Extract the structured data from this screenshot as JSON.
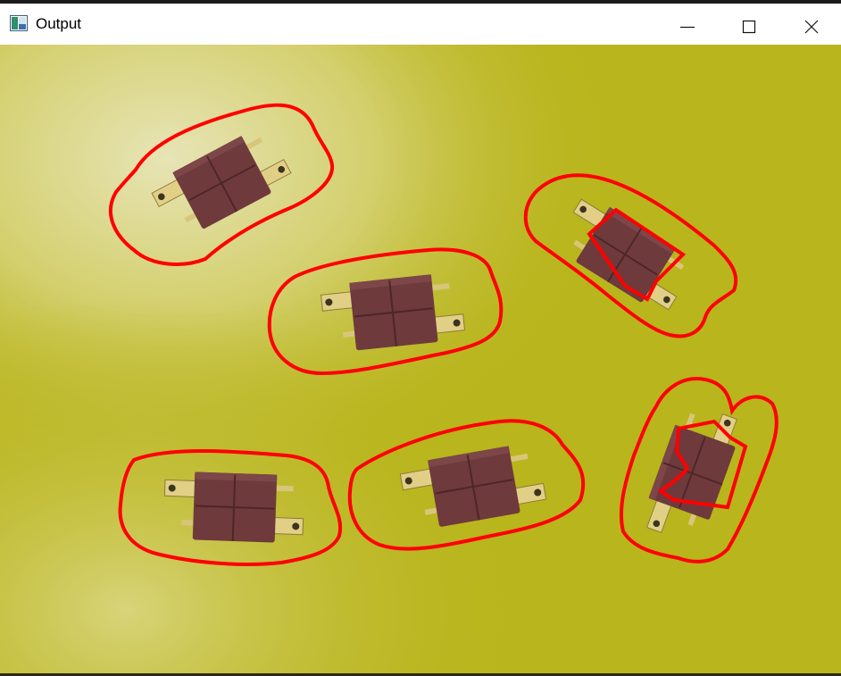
{
  "window": {
    "title": "Output",
    "icon": "app-window-icon"
  },
  "controls": {
    "minimize": "minimize-icon",
    "maximize": "maximize-icon",
    "close": "close-icon"
  },
  "image": {
    "background_color": "#b9b51c",
    "highlight_color": "#e8e6b8",
    "connector_color": "#6e3a3c",
    "pin_color": "#e2cf86",
    "contour_color": "#ff0000"
  }
}
